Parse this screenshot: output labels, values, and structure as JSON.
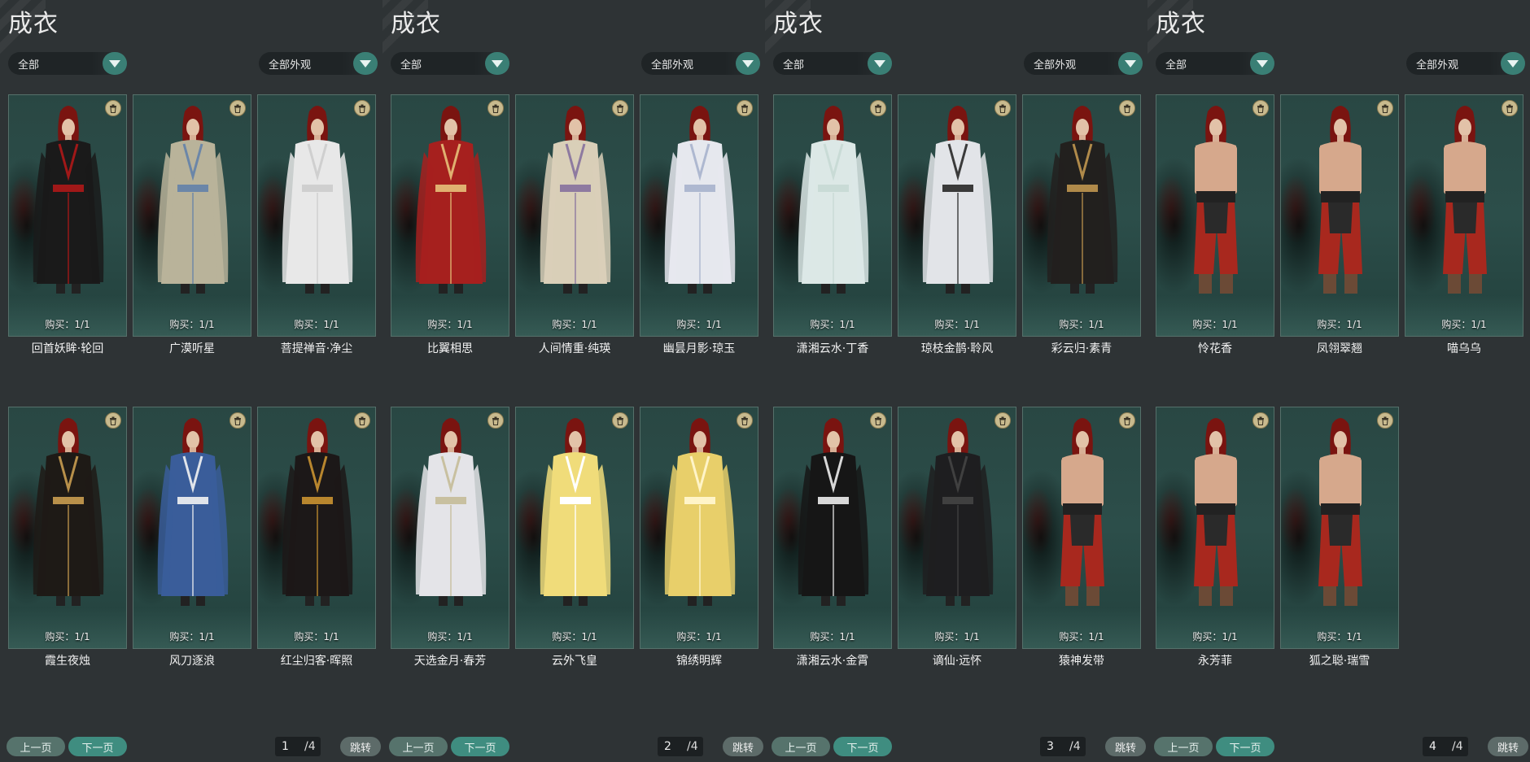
{
  "colors": {
    "background": "#2e3335",
    "card_bg": "#294743",
    "accent_teal": "#3a7f75",
    "trash_badge": "#c8ba8e"
  },
  "panels": [
    {
      "title": "成衣",
      "filter_left": "全部",
      "filter_right": "全部外观",
      "items": [
        {
          "name": "回首妖眸·轮回",
          "buy": "购买：1/1",
          "skin": "#1a1a1a",
          "accent": "#a01818",
          "style": "dark"
        },
        {
          "name": "广漠听星",
          "buy": "购买：1/1",
          "skin": "#b9b39a",
          "accent": "#6b86a8",
          "style": "robe"
        },
        {
          "name": "菩提禅音·净尘",
          "buy": "购买：1/1",
          "skin": "#e8e8e8",
          "accent": "#cfcfcf",
          "style": "robe"
        },
        {
          "name": "霞生夜烛",
          "buy": "购买：1/1",
          "skin": "#1e1a16",
          "accent": "#b8904a",
          "style": "dark"
        },
        {
          "name": "风刀逐浪",
          "buy": "购买：1/1",
          "skin": "#3a5d9a",
          "accent": "#e0e4ea",
          "style": "robe"
        },
        {
          "name": "红尘归客·晖照",
          "buy": "购买：1/1",
          "skin": "#1c1818",
          "accent": "#b8862e",
          "style": "dark"
        }
      ],
      "prev": "上一页",
      "next": "下一页",
      "page_current": "1",
      "page_total": "/4",
      "jump": "跳转"
    },
    {
      "title": "成衣",
      "filter_left": "全部",
      "filter_right": "全部外观",
      "items": [
        {
          "name": "比翼相思",
          "buy": "购买：1/1",
          "skin": "#a6201e",
          "accent": "#e0b070",
          "style": "robe"
        },
        {
          "name": "人间情重·纯瑛",
          "buy": "购买：1/1",
          "skin": "#d9cfb8",
          "accent": "#8e7aa0",
          "style": "robe"
        },
        {
          "name": "幽昙月影·琼玉",
          "buy": "购买：1/1",
          "skin": "#e6e8ee",
          "accent": "#aeb8d0",
          "style": "robe"
        },
        {
          "name": "天选金月·春芳",
          "buy": "购买：1/1",
          "skin": "#e4e4e8",
          "accent": "#c8c0a0",
          "style": "robe"
        },
        {
          "name": "云外飞皇",
          "buy": "购买：1/1",
          "skin": "#f0dc7a",
          "accent": "#ffffff",
          "style": "robe"
        },
        {
          "name": "锦绣明辉",
          "buy": "购买：1/1",
          "skin": "#e8cf6a",
          "accent": "#fff4c8",
          "style": "robe"
        }
      ],
      "prev": "上一页",
      "next": "下一页",
      "page_current": "2",
      "page_total": "/4",
      "jump": "跳转"
    },
    {
      "title": "成衣",
      "filter_left": "全部",
      "filter_right": "全部外观",
      "items": [
        {
          "name": "潇湘云水·丁香",
          "buy": "购买：1/1",
          "skin": "#dce8e6",
          "accent": "#c9dbd6",
          "style": "robe"
        },
        {
          "name": "琼枝金鹊·聆风",
          "buy": "购买：1/1",
          "skin": "#e2e4e8",
          "accent": "#3a3a3a",
          "style": "robe"
        },
        {
          "name": "彩云归·素青",
          "buy": "购买：1/1",
          "skin": "#22201e",
          "accent": "#b08a4a",
          "style": "dark"
        },
        {
          "name": "潇湘云水·金霄",
          "buy": "购买：1/1",
          "skin": "#161616",
          "accent": "#d8d8d8",
          "style": "dark"
        },
        {
          "name": "谪仙·远怀",
          "buy": "购买：1/1",
          "skin": "#1e1e20",
          "accent": "#404040",
          "style": "dark"
        },
        {
          "name": "猿神发带",
          "buy": "购买：1/1",
          "skin": "#a8281e",
          "accent": "#d09a80",
          "style": "bare"
        }
      ],
      "prev": "上一页",
      "next": "下一页",
      "page_current": "3",
      "page_total": "/4",
      "jump": "跳转"
    },
    {
      "title": "成衣",
      "filter_left": "全部",
      "filter_right": "全部外观",
      "items": [
        {
          "name": "怜花香",
          "buy": "购买：1/1",
          "skin": "#a8281e",
          "accent": "#d09a80",
          "style": "bare"
        },
        {
          "name": "凤翎翠翘",
          "buy": "购买：1/1",
          "skin": "#a8281e",
          "accent": "#d09a80",
          "style": "bare"
        },
        {
          "name": "喵乌乌",
          "buy": "购买：1/1",
          "skin": "#a8281e",
          "accent": "#d09a80",
          "style": "bare"
        },
        {
          "name": "永芳菲",
          "buy": "购买：1/1",
          "skin": "#a8281e",
          "accent": "#d09a80",
          "style": "bare"
        },
        {
          "name": "狐之聪·瑞雪",
          "buy": "购买：1/1",
          "skin": "#a8281e",
          "accent": "#d09a80",
          "style": "bare"
        }
      ],
      "prev": "上一页",
      "next": "下一页",
      "page_current": "4",
      "page_total": "/4",
      "jump": "跳转"
    }
  ]
}
